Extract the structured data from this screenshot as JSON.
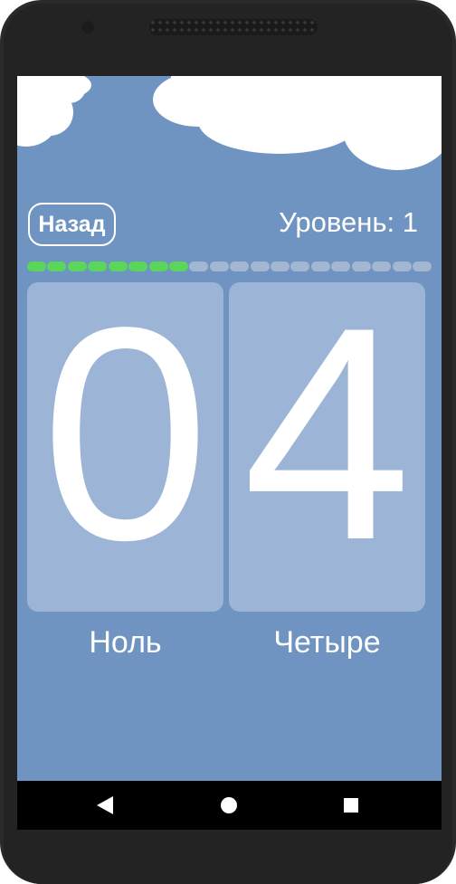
{
  "header": {
    "back_label": "Назад",
    "level_label": "Уровень: 1"
  },
  "progress": {
    "completed": 8,
    "total": 20,
    "completed_color": "#5ad65a",
    "remaining_color": "#a3b6d2"
  },
  "cards": [
    {
      "digit": "0",
      "word": "Ноль"
    },
    {
      "digit": "4",
      "word": "Четыре"
    }
  ],
  "colors": {
    "background": "#7094c1",
    "card": "#9cb4d5",
    "text": "#ffffff"
  },
  "navbar": {
    "icons": [
      "back-triangle-icon",
      "home-circle-icon",
      "recents-square-icon"
    ]
  }
}
